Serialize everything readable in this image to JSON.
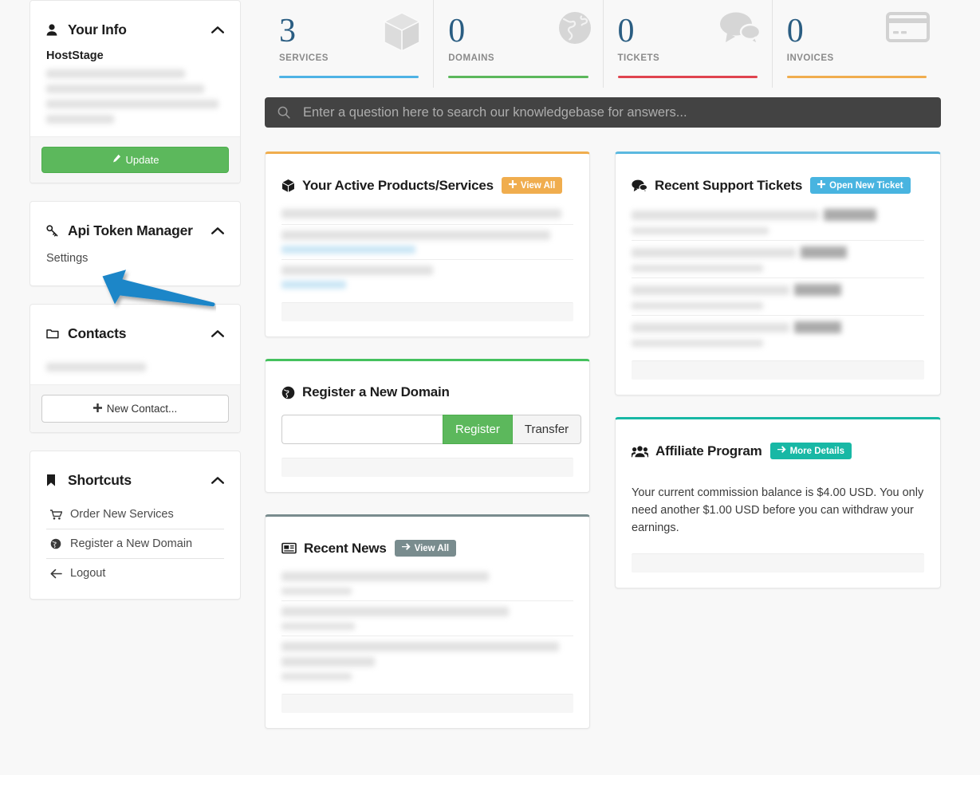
{
  "sidebar": {
    "your_info": {
      "title": "Your Info",
      "icon": "user-icon",
      "caret": "chevron-up-icon",
      "account_name": "HostStage",
      "redacted_lines": 4,
      "update_label": "Update",
      "update_icon": "pencil-icon"
    },
    "api_token_manager": {
      "title": "Api Token Manager",
      "icon": "key-icon",
      "caret": "chevron-up-icon",
      "settings_label": "Settings"
    },
    "contacts": {
      "title": "Contacts",
      "icon": "folder-icon",
      "caret": "chevron-up-icon",
      "redacted_lines": 1,
      "new_contact_label": "New Contact...",
      "new_contact_icon": "plus-icon"
    },
    "shortcuts": {
      "title": "Shortcuts",
      "icon": "bookmark-icon",
      "caret": "chevron-up-icon",
      "items": [
        {
          "label": "Order New Services",
          "icon": "cart-icon"
        },
        {
          "label": "Register a New Domain",
          "icon": "globe-icon"
        },
        {
          "label": "Logout",
          "icon": "arrow-left-icon"
        }
      ]
    }
  },
  "stats": [
    {
      "value": "3",
      "label": "SERVICES",
      "icon": "cube-icon",
      "bar_color": "#4eb3e5"
    },
    {
      "value": "0",
      "label": "DOMAINS",
      "icon": "globe-icon",
      "bar_color": "#5cb85c"
    },
    {
      "value": "0",
      "label": "TICKETS",
      "icon": "comments-icon",
      "bar_color": "#e0444f"
    },
    {
      "value": "0",
      "label": "INVOICES",
      "icon": "credit-card-icon",
      "bar_color": "#f0ad4e"
    }
  ],
  "search": {
    "placeholder": "Enter a question here to search our knowledgebase for answers...",
    "value": "",
    "icon": "search-icon"
  },
  "cards": {
    "products": {
      "title": "Your Active Products/Services",
      "icon": "cube-icon",
      "accent": "#f0ad4e",
      "button": {
        "label": "View All",
        "icon": "plus-icon",
        "color": "#f0ad4e"
      },
      "rows_redacted": 3
    },
    "domain": {
      "title": "Register a New Domain",
      "icon": "globe-icon",
      "accent": "#45c15e",
      "input_value": "",
      "input_placeholder": "",
      "register_label": "Register",
      "transfer_label": "Transfer"
    },
    "news": {
      "title": "Recent News",
      "icon": "newspaper-icon",
      "accent": "#798c8e",
      "button": {
        "label": "View All",
        "icon": "arrow-right-icon",
        "color": "#798c8e"
      },
      "rows_redacted": 3
    },
    "tickets": {
      "title": "Recent Support Tickets",
      "icon": "comments-icon",
      "accent": "#5bb9e0",
      "button": {
        "label": "Open New Ticket",
        "icon": "plus-icon",
        "color": "#48b4e0"
      },
      "rows_redacted": 4
    },
    "affiliate": {
      "title": "Affiliate Program",
      "icon": "users-icon",
      "accent": "#18b8a5",
      "button": {
        "label": "More Details",
        "icon": "arrow-right-icon",
        "color": "#18b8a5"
      },
      "body_text": "Your current commission balance is $4.00 USD. You only need another $1.00 USD before you can withdraw your earnings."
    }
  },
  "annotation": {
    "type": "arrow",
    "points_to": "Settings",
    "color": "#1f86c8"
  }
}
